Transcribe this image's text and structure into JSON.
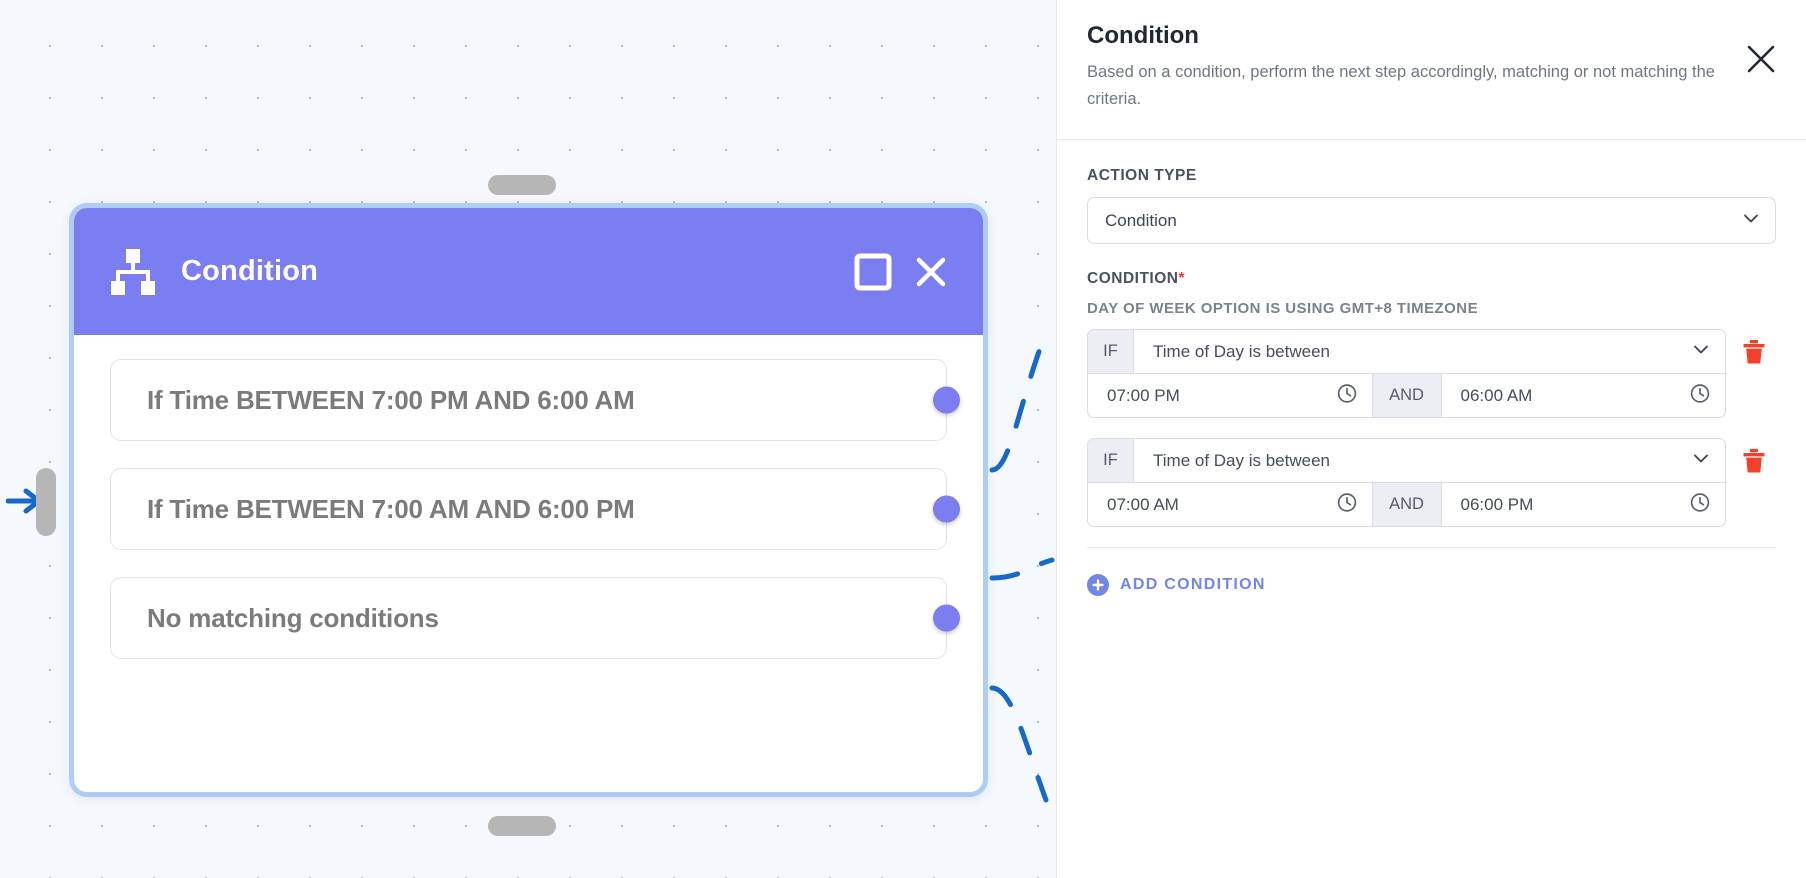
{
  "canvas": {
    "node": {
      "title": "Condition",
      "icon": "sitemap-icon",
      "header_color": "#7b7ef0",
      "selection_border_color": "#aecdf5",
      "maximize_label": "maximize",
      "close_label": "close",
      "branches": [
        {
          "label": "If Time BETWEEN 7:00 PM AND 6:00 AM",
          "port_color": "#7b7ef0"
        },
        {
          "label": "If Time BETWEEN 7:00 AM AND 6:00 PM",
          "port_color": "#7b7ef0"
        },
        {
          "label": "No matching conditions",
          "port_color": "#7b7ef0"
        }
      ]
    },
    "handles": {
      "left": "input-handle",
      "top": "top-handle",
      "bottom": "bottom-handle",
      "incoming_arrow": "incoming-arrow"
    }
  },
  "panel": {
    "title": "Condition",
    "description": "Based on a condition, perform the next step accordingly, matching or not matching the criteria.",
    "close_label": "close",
    "action_type": {
      "label": "Action Type",
      "value": "Condition"
    },
    "condition": {
      "label": "Condition",
      "required_mark": "*",
      "note": "Day of week option is using GMT+8 timezone",
      "if_tag": "IF",
      "and_tag": "AND",
      "delete_label": "delete condition",
      "delete_color": "#f4402b",
      "rows": [
        {
          "operator": "Time of Day is between",
          "from": "07:00 PM",
          "to": "06:00 AM"
        },
        {
          "operator": "Time of Day is between",
          "from": "07:00 AM",
          "to": "06:00 PM"
        }
      ]
    },
    "add_condition": {
      "label": "Add Condition",
      "accent": "#7286e8"
    }
  }
}
